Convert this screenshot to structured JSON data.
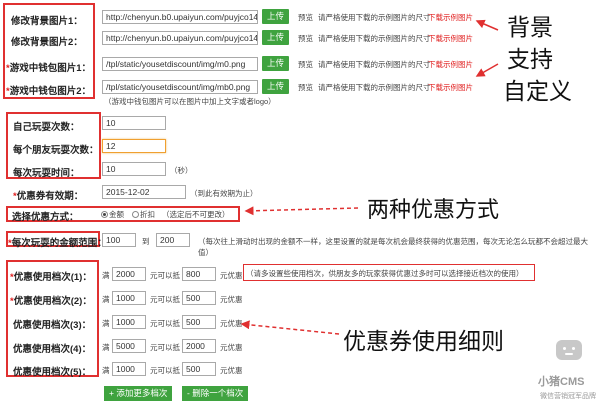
{
  "bg": {
    "label1": "修改背景图片1：",
    "label2": "修改背景图片2：",
    "value1": "http://chenyun.b0.upaiyun.com/puyjco14391",
    "value2": "http://chenyun.b0.upaiyun.com/puyjco14391",
    "upload": "上传",
    "preview": "预览",
    "hint": "请严格使用下载的示例图片的尺寸",
    "download": "下载示例图片"
  },
  "wallet": {
    "label1": "游戏中钱包图片1：",
    "label2": "游戏中钱包图片2：",
    "value1": "/tpl/static/yousetdiscount/img/m0.png",
    "value2": "/tpl/static/yousetdiscount/img/mb0.png",
    "note": "（游戏中钱包图片可以在图片中加上文字或者logo）"
  },
  "play": {
    "self_label": "自己玩耍次数：",
    "self_value": "10",
    "friend_label": "每个朋友玩耍次数：",
    "friend_value": "12",
    "time_label": "每次玩耍时间：",
    "time_value": "10",
    "time_unit": "（秒）"
  },
  "valid": {
    "label": "优惠券有效期：",
    "value": "2015-12-02",
    "note": "（到此有效期为止）"
  },
  "mode": {
    "label": "选择优惠方式：",
    "opt1": "金额",
    "opt2": "折扣",
    "note": "（选定后不可更改）"
  },
  "range": {
    "label": "每次玩耍的金额范围：",
    "min": "100",
    "sep": "到",
    "max": "200",
    "note1": "（每次往上滑动时出现的金额不一样，这里设置的就是每次机会最终获得的优惠范围，每次无论怎么玩都不会超过最大",
    "note2": "值）"
  },
  "tiers": [
    {
      "label": "优惠使用档次(1)：",
      "full": "2000",
      "deduct": "800",
      "star": true
    },
    {
      "label": "优惠使用档次(2)：",
      "full": "1000",
      "deduct": "500",
      "star": true
    },
    {
      "label": "优惠使用档次(3)：",
      "full": "1000",
      "deduct": "500",
      "star": false
    },
    {
      "label": "优惠使用档次(4)：",
      "full": "5000",
      "deduct": "2000",
      "star": false
    },
    {
      "label": "优惠使用档次(5)：",
      "full": "1000",
      "deduct": "500",
      "star": false
    }
  ],
  "tier_text": {
    "man": "满",
    "yuan_di": "元可以抵",
    "yuan_hui": "元优惠",
    "note": "（请多设置些使用档次，供朋友多的玩家获得优惠过多时可以选择接近档次的使用）"
  },
  "actions": {
    "add": "+ 添加更多档次",
    "remove": "- 删除一个档次"
  },
  "annotations": {
    "a1": "背景",
    "a2": "支持",
    "a3": "自定义",
    "a4": "两种优惠方式",
    "a5": "优惠券使用细则"
  },
  "watermark": {
    "brand": "小猪CMS",
    "slogan": "微信营销冠军品牌"
  },
  "colors": {
    "accent_green": "#3fa33f",
    "alert_red": "#e02020"
  }
}
